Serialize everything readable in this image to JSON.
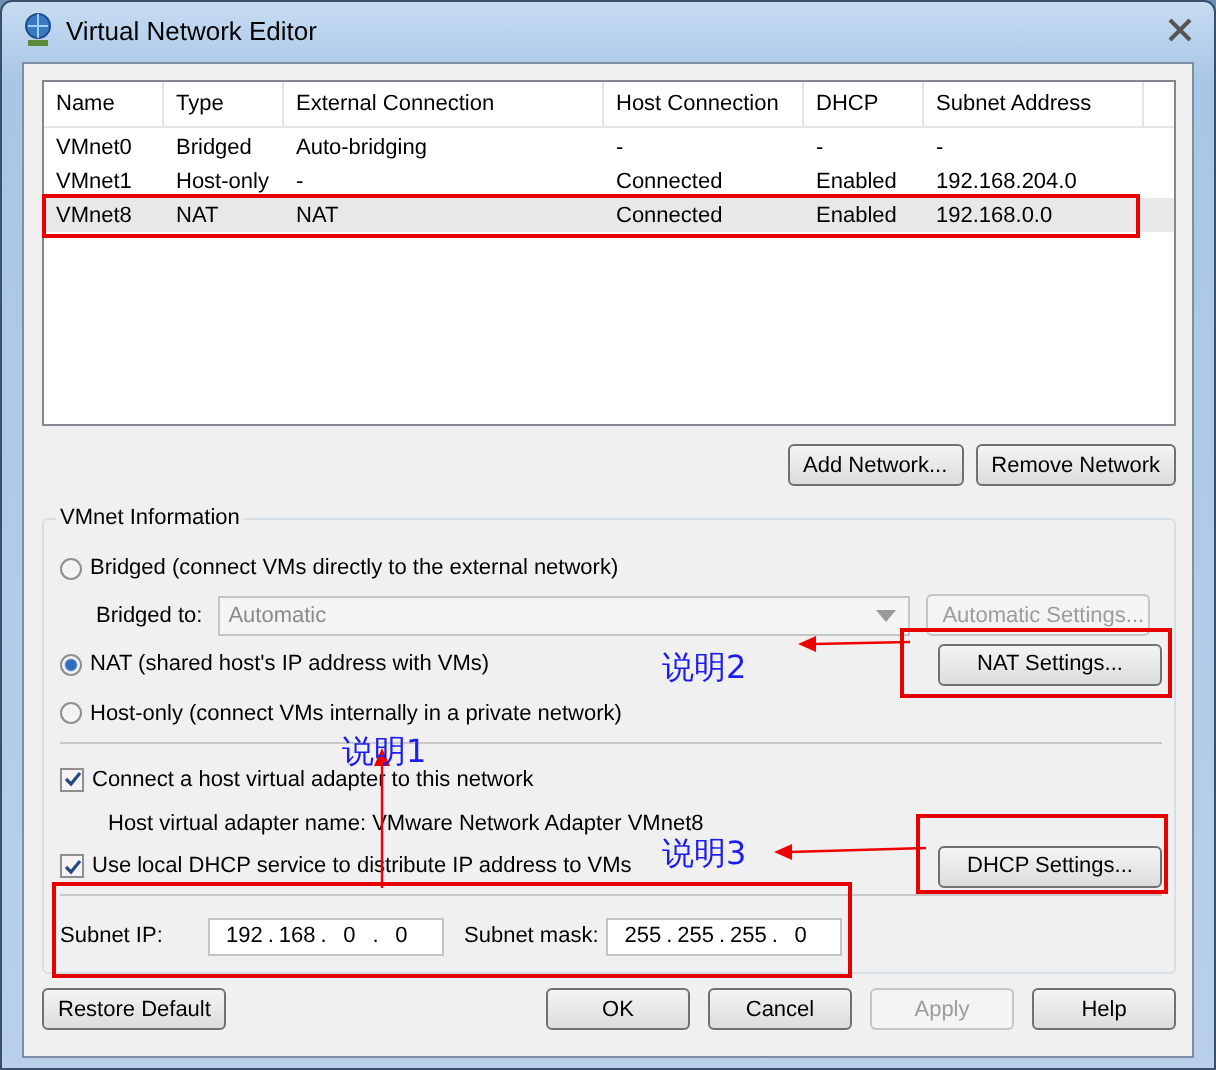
{
  "window": {
    "title": "Virtual Network Editor"
  },
  "table": {
    "columns": [
      "Name",
      "Type",
      "External Connection",
      "Host Connection",
      "DHCP",
      "Subnet Address"
    ],
    "rows": [
      {
        "cells": [
          "VMnet0",
          "Bridged",
          "Auto-bridging",
          "-",
          "-",
          "-"
        ],
        "selected": false
      },
      {
        "cells": [
          "VMnet1",
          "Host-only",
          "-",
          "Connected",
          "Enabled",
          "192.168.204.0"
        ],
        "selected": false
      },
      {
        "cells": [
          "VMnet8",
          "NAT",
          "NAT",
          "Connected",
          "Enabled",
          "192.168.0.0"
        ],
        "selected": true
      }
    ]
  },
  "list_buttons": [
    {
      "label": "Add Network...",
      "disabled": false
    },
    {
      "label": "Remove Network",
      "disabled": false
    }
  ],
  "vmnet_information": {
    "title": "VMnet Information",
    "bridged": {
      "label": "Bridged (connect VMs directly to the external network)",
      "selected": false
    },
    "bridged_to": {
      "label": "Bridged to:",
      "value": "Automatic",
      "disabled": true
    },
    "automatic_settings": {
      "label": "Automatic Settings...",
      "disabled": true
    },
    "nat": {
      "label": "NAT (shared host's IP address with VMs)",
      "selected": true
    },
    "nat_settings": {
      "label": "NAT Settings...",
      "disabled": false
    },
    "host_only": {
      "label": "Host-only (connect VMs internally in a private network)",
      "selected": false
    },
    "connect_adapter": {
      "label": "Connect a host virtual adapter to this network",
      "checked": true
    },
    "adapter_name": "Host virtual adapter name: VMware Network Adapter VMnet8",
    "use_dhcp": {
      "label": "Use local DHCP service to distribute IP address to VMs",
      "checked": true
    },
    "dhcp_settings": {
      "label": "DHCP Settings...",
      "disabled": false
    },
    "subnet_ip": {
      "label": "Subnet IP:",
      "octets": [
        "192",
        "168",
        "0",
        "0"
      ],
      "separator": "."
    },
    "subnet_mask": {
      "label": "Subnet mask:",
      "octets": [
        "255",
        "255",
        "255",
        "0"
      ],
      "separator": "."
    }
  },
  "footer_buttons": [
    {
      "label": "Restore Default",
      "disabled": false
    },
    {
      "label": "OK",
      "disabled": false
    },
    {
      "label": "Cancel",
      "disabled": false
    },
    {
      "label": "Apply",
      "disabled": true
    },
    {
      "label": "Help",
      "disabled": false
    }
  ],
  "annotations": [
    {
      "label": "说明2"
    },
    {
      "label": "说明1"
    },
    {
      "label": "说明3"
    }
  ]
}
